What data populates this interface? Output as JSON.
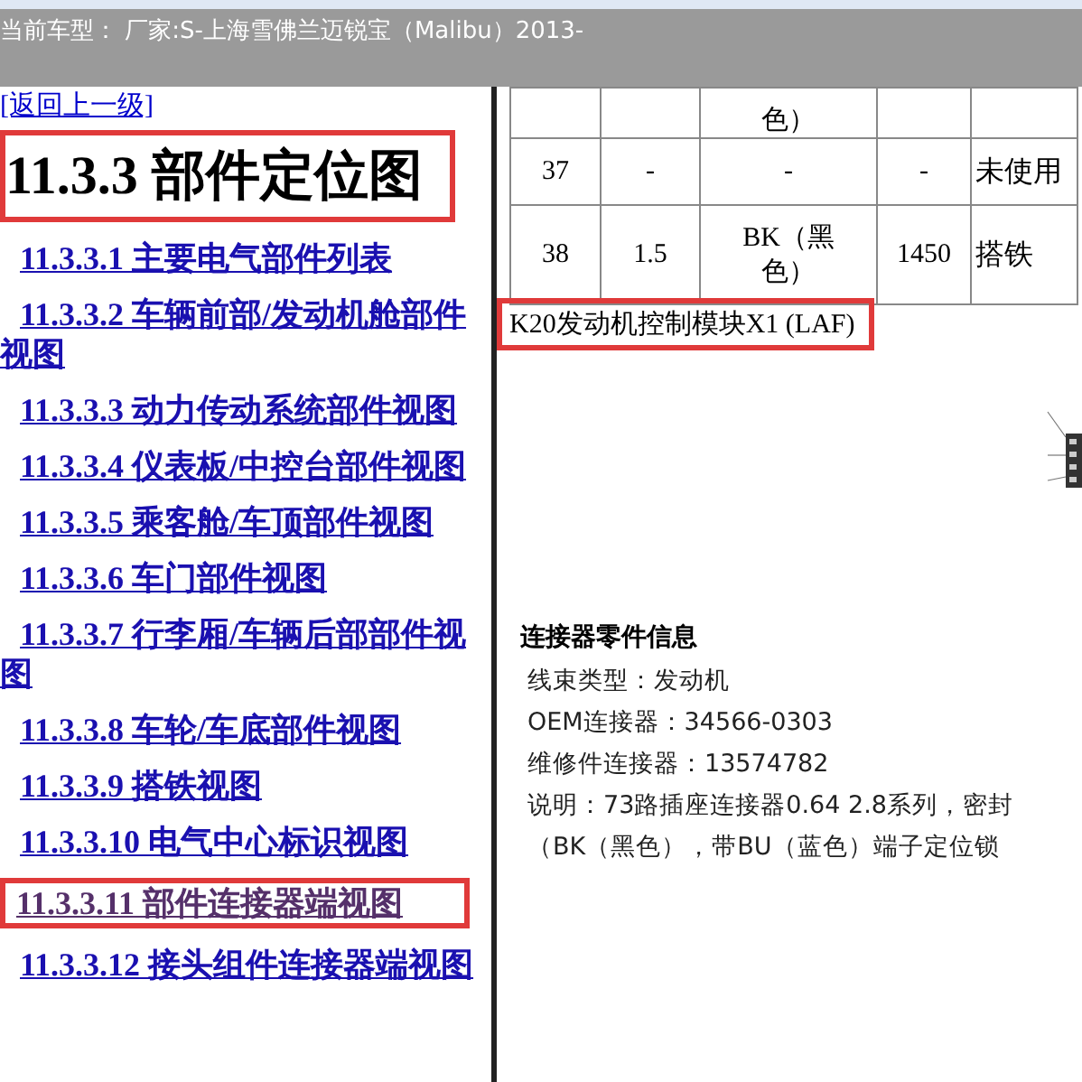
{
  "header": {
    "title": "当前车型： 厂家:S-上海雪佛兰迈锐宝（Malibu）2013-"
  },
  "sidebar": {
    "back_link": "[返回上一级]",
    "heading": "11.3.3 部件定位图",
    "items": [
      {
        "label": "11.3.3.1 主要电气部件列表",
        "visited": false,
        "highlighted": false
      },
      {
        "label": "11.3.3.2 车辆前部/发动机舱部件视图",
        "visited": false,
        "highlighted": false
      },
      {
        "label": "11.3.3.3 动力传动系统部件视图",
        "visited": false,
        "highlighted": false
      },
      {
        "label": "11.3.3.4 仪表板/中控台部件视图",
        "visited": false,
        "highlighted": false
      },
      {
        "label": "11.3.3.5 乘客舱/车顶部件视图",
        "visited": false,
        "highlighted": false
      },
      {
        "label": "11.3.3.6 车门部件视图",
        "visited": false,
        "highlighted": false
      },
      {
        "label": "11.3.3.7 行李厢/车辆后部部件视图",
        "visited": false,
        "highlighted": false
      },
      {
        "label": "11.3.3.8 车轮/车底部件视图",
        "visited": false,
        "highlighted": false
      },
      {
        "label": "11.3.3.9 搭铁视图",
        "visited": false,
        "highlighted": false
      },
      {
        "label": "11.3.3.10 电气中心标识视图",
        "visited": false,
        "highlighted": false
      },
      {
        "label": "11.3.3.11 部件连接器端视图",
        "visited": true,
        "highlighted": true
      },
      {
        "label": "11.3.3.12 接头组件连接器端视图",
        "visited": false,
        "highlighted": false
      }
    ]
  },
  "table": {
    "rows": [
      {
        "cells": [
          "",
          "",
          "色）",
          "",
          ""
        ]
      },
      {
        "cells": [
          "37",
          "-",
          "-",
          "-",
          "未使用"
        ]
      },
      {
        "cells": [
          "38",
          "1.5",
          "BK（黑色）",
          "1450",
          "搭铁"
        ]
      }
    ]
  },
  "caption": "K20发动机控制模块X1 (LAF)",
  "connector_info": {
    "title": "连接器零件信息",
    "lines": [
      "线束类型：发动机",
      "OEM连接器：34566-0303",
      "维修件连接器：13574782",
      "说明：73路插座连接器0.64 2.8系列，密封",
      "（BK（黑色），带BU（蓝色）端子定位锁"
    ]
  }
}
